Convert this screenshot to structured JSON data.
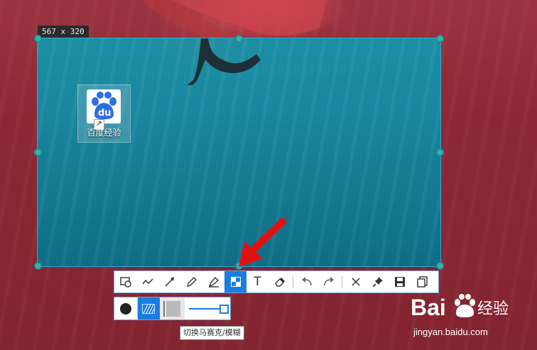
{
  "selection": {
    "size_label": "567 x 320"
  },
  "desktop_icon": {
    "label": "百度经验",
    "tile_text": "du"
  },
  "toolbar": {
    "tools": [
      {
        "name": "rectangle-tool",
        "icon": "shape-icon"
      },
      {
        "name": "freehand-tool",
        "icon": "polyline-icon"
      },
      {
        "name": "arrow-tool",
        "icon": "arrow-icon"
      },
      {
        "name": "pencil-tool",
        "icon": "pencil-icon"
      },
      {
        "name": "highlighter-tool",
        "icon": "marker-icon"
      },
      {
        "name": "mosaic-tool",
        "icon": "mosaic-icon",
        "active": true
      },
      {
        "name": "text-tool",
        "icon": "text-icon"
      },
      {
        "name": "eraser-tool",
        "icon": "eraser-icon"
      },
      {
        "name": "undo-button",
        "icon": "undo-icon"
      },
      {
        "name": "redo-button",
        "icon": "redo-icon"
      },
      {
        "name": "close-button",
        "icon": "close-icon"
      },
      {
        "name": "pin-button",
        "icon": "pin-icon"
      },
      {
        "name": "save-button",
        "icon": "save-icon"
      },
      {
        "name": "copy-button",
        "icon": "copy-icon"
      }
    ],
    "text_tool_glyph": "T"
  },
  "subbar": {
    "tooltip": "切换马赛克/模糊"
  },
  "watermark": {
    "brand": "Bai",
    "brand_suffix": "经验",
    "url": "jingyan.baidu.com"
  },
  "colors": {
    "accent": "#1a7de0",
    "annotation": "#e31010",
    "selection_border": "#27a9d8"
  }
}
